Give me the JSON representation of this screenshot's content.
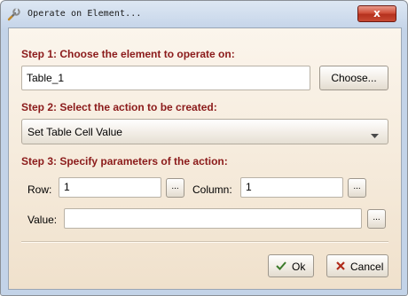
{
  "window": {
    "title": "Operate on Element...",
    "close_label": "x"
  },
  "step1": {
    "heading": "Step 1: Choose the element to operate on:",
    "element_value": "Table_1",
    "choose_label": "Choose..."
  },
  "step2": {
    "heading": "Step 2: Select the action to be created:",
    "action_value": "Set Table Cell Value"
  },
  "step3": {
    "heading": "Step 3: Specify parameters of the action:",
    "row_label": "Row:",
    "row_value": "1",
    "column_label": "Column:",
    "column_value": "1",
    "value_label": "Value:",
    "value_value": "",
    "ellipsis": "..."
  },
  "footer": {
    "ok_label": "Ok",
    "cancel_label": "Cancel"
  },
  "colors": {
    "heading": "#8b1a1a",
    "client_bg": "#f6ecdf"
  },
  "icons": {
    "app": "wrench-icon",
    "ok": "check-icon",
    "cancel": "x-icon"
  }
}
